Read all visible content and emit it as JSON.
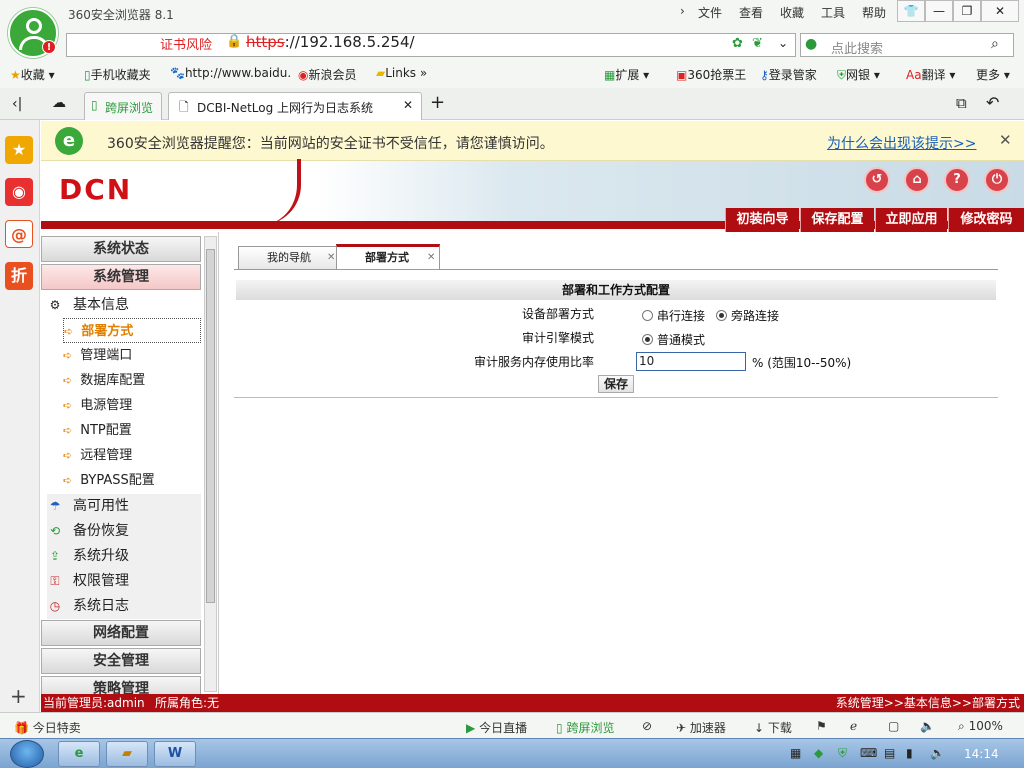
{
  "window": {
    "title": "360安全浏览器 8.1",
    "menu": [
      "文件",
      "查看",
      "收藏",
      "工具",
      "帮助"
    ],
    "win_controls": [
      "restore",
      "minimize",
      "maximize",
      "close"
    ]
  },
  "address_bar": {
    "cert_warning": "证书风险",
    "url_scheme": "https",
    "url_rest": "://192.168.5.254/",
    "search_placeholder": "点此搜索"
  },
  "bookmarks": {
    "left": [
      "收藏",
      "手机收藏夹",
      "http://www.baidu.",
      "新浪会员",
      "Links"
    ],
    "right": [
      "扩展",
      "360抢票王",
      "登录管家",
      "网银",
      "翻译",
      "更多"
    ]
  },
  "tabs": {
    "items": [
      {
        "label": "跨屏浏览"
      },
      {
        "label": "DCBI-NetLog 上网行为日志系统",
        "active": true
      }
    ]
  },
  "warning": {
    "text": "360安全浏览器提醒您：当前网站的安全证书不受信任，请您谨慎访问。",
    "link": "为什么会出现该提示>>"
  },
  "header": {
    "logo": "DCN",
    "buttons": [
      "初装向导",
      "保存配置",
      "立即应用",
      "修改密码"
    ]
  },
  "sidebar": {
    "sections": [
      {
        "label": "系统状态"
      },
      {
        "label": "系统管理",
        "active": true
      }
    ],
    "basic_info": "基本信息",
    "sub_items": [
      "部署方式",
      "管理端口",
      "数据库配置",
      "电源管理",
      "NTP配置",
      "远程管理",
      "BYPASS配置"
    ],
    "items": [
      "高可用性",
      "备份恢复",
      "系统升级",
      "权限管理",
      "系统日志"
    ],
    "bottom_sections": [
      "网络配置",
      "安全管理",
      "策略管理"
    ]
  },
  "content": {
    "tabs": [
      "我的导航",
      "部署方式"
    ],
    "card_title": "部署和工作方式配置",
    "rows": [
      {
        "label": "设备部署方式",
        "options": [
          "串行连接",
          "旁路连接"
        ],
        "selected": 1
      },
      {
        "label": "审计引擎模式",
        "options": [
          "普通模式"
        ],
        "selected": 0
      },
      {
        "label": "审计服务内存使用比率",
        "value": "10",
        "suffix": "% (范围10--50%)"
      }
    ],
    "save_label": "保存"
  },
  "status_strip": {
    "user": "当前管理员:admin",
    "role": "所属角色:无",
    "breadcrumb": "系统管理>>基本信息>>部署方式"
  },
  "browser_status": {
    "left": "今日特卖",
    "right": [
      "今日直播",
      "跨屏浏览",
      "加速器",
      "下载",
      "100%"
    ]
  },
  "taskbar": {
    "clock": "14:14"
  },
  "colors": {
    "brand_red": "#b00d12",
    "warn_bg": "#fdf8d0",
    "link_blue": "#1a5fb4"
  }
}
